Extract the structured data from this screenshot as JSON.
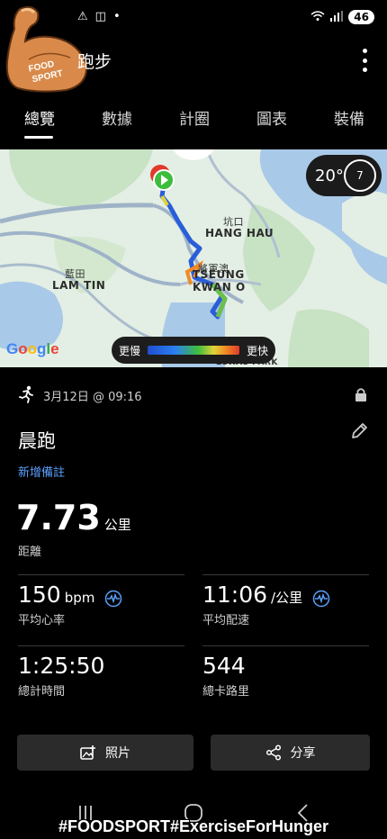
{
  "status_bar": {
    "battery": "46"
  },
  "header": {
    "title": "跑步"
  },
  "tabs": [
    "總覽",
    "數據",
    "計圈",
    "圖表",
    "裝備"
  ],
  "map": {
    "labels": {
      "hang_hau_cn": "坑口",
      "hang_hau": "HANG HAU",
      "lam_tin_cn": "藍田",
      "lam_tin": "LAM TIN",
      "tko_cn": "將軍澳",
      "tko_1": "TSEUNG",
      "tko_2": "KWAN O",
      "lohas": "LOHAS PARK"
    },
    "weather_temp": "20°",
    "weather_level": "7",
    "google": "Google",
    "speed_slow": "更慢",
    "speed_fast": "更快"
  },
  "activity": {
    "date": "3月12日 @ 09:16",
    "title": "晨跑",
    "add_note": "新增備註",
    "distance_value": "7.73",
    "distance_unit": "公里",
    "distance_label": "距離",
    "heart_rate_value": "150",
    "heart_rate_unit": "bpm",
    "heart_rate_label": "平均心率",
    "pace_value": "11:06",
    "pace_unit": "/公里",
    "pace_label": "平均配速",
    "time_value": "1:25:50",
    "time_label": "總計時間",
    "calories_value": "544",
    "calories_label": "總卡路里"
  },
  "buttons": {
    "photos": "照片",
    "share": "分享"
  },
  "logo_text": "FOOD SPORT",
  "watermark": "#FOODSPORT#ExerciseForHunger",
  "colors": {
    "accent_blue": "#5aa0ff",
    "background": "#000000",
    "button_bg": "#2b2b2b"
  }
}
